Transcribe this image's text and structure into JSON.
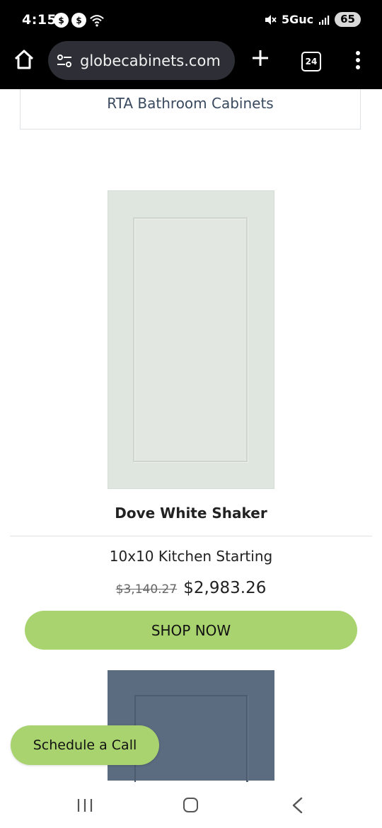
{
  "status_bar": {
    "time": "4:15",
    "left_icons": [
      "$",
      "$"
    ],
    "network": "5Guc",
    "battery": "65"
  },
  "browser": {
    "url": "globecabinets.com",
    "tab_count": "24"
  },
  "page": {
    "category_label": "RTA Bathroom Cabinets",
    "product": {
      "name": "Dove White Shaker",
      "subtitle": "10x10 Kitchen Starting",
      "old_price": "$3,140.27",
      "new_price": "$2,983.26",
      "cta": "SHOP NOW"
    },
    "floating_cta": "Schedule a Call"
  },
  "colors": {
    "accent_green": "#a9d36f",
    "door_white": "#dfe5df",
    "door_blue": "#5b6b80",
    "chrome": "#000000"
  },
  "icons": [
    "home-icon",
    "site-settings-icon",
    "plus-icon",
    "tabs-icon",
    "more-vert-icon",
    "wifi-icon",
    "mute-icon",
    "signal-icon",
    "recent-apps-icon",
    "nav-home-icon",
    "back-icon"
  ]
}
